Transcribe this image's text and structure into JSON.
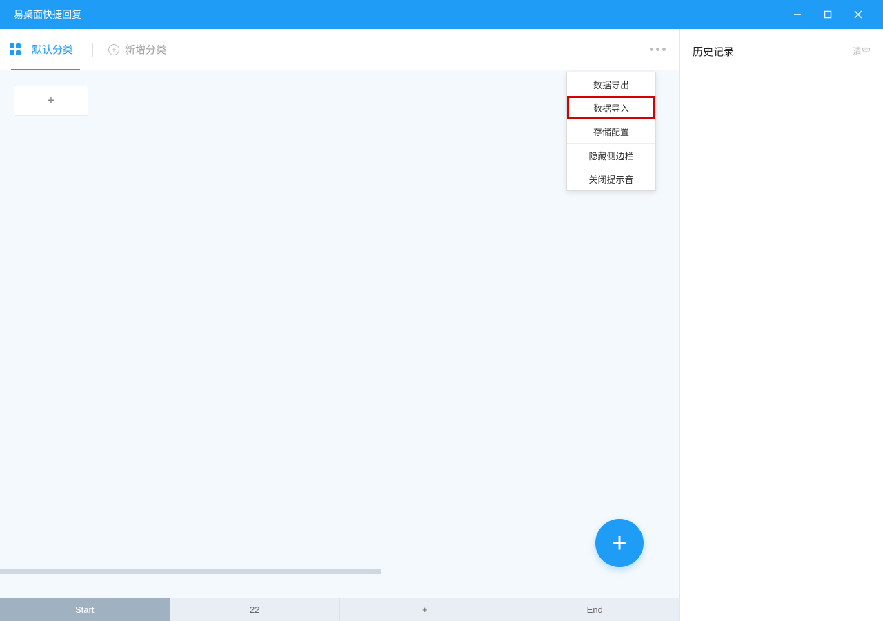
{
  "titlebar": {
    "title": "易桌面快捷回复"
  },
  "tabs": {
    "active_label": "默认分类",
    "add_label": "新增分类"
  },
  "dropdown": {
    "items": [
      {
        "label": "数据导出",
        "highlighted": false
      },
      {
        "label": "数据导入",
        "highlighted": true
      },
      {
        "label": "存储配置",
        "highlighted": false
      },
      {
        "label": "隐藏侧边栏",
        "highlighted": false,
        "separator_before": true
      },
      {
        "label": "关闭提示音",
        "highlighted": false
      }
    ]
  },
  "bottom_tabs": {
    "items": [
      {
        "label": "Start",
        "active": true
      },
      {
        "label": "22",
        "active": false
      },
      {
        "label": "+",
        "active": false
      },
      {
        "label": "End",
        "active": false
      }
    ]
  },
  "history": {
    "title": "历史记录",
    "clear": "清空"
  }
}
